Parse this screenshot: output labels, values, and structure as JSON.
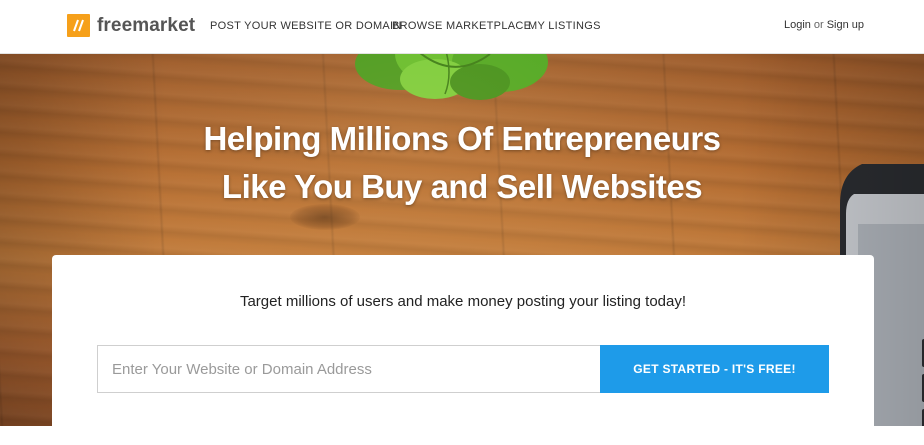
{
  "header": {
    "logo_text": "freemarket",
    "nav": [
      {
        "label": "POST YOUR WEBSITE OR DOMAIN"
      },
      {
        "label": "BROWSE MARKETPLACE"
      },
      {
        "label": "MY LISTINGS"
      }
    ],
    "auth": {
      "login": "Login",
      "or": "or",
      "signup": "Sign up"
    }
  },
  "hero": {
    "title_line1": "Helping Millions Of Entrepreneurs",
    "title_line2": "Like You Buy and Sell Websites"
  },
  "card": {
    "tagline": "Target millions of users and make money posting your listing today!",
    "input": {
      "placeholder": "Enter Your Website or Domain Address",
      "value": ""
    },
    "cta_label": "GET STARTED - IT'S FREE!"
  },
  "colors": {
    "brand_orange": "#f6a01a",
    "cta_blue": "#1e9be9",
    "hero_wood": "#b26a30"
  }
}
